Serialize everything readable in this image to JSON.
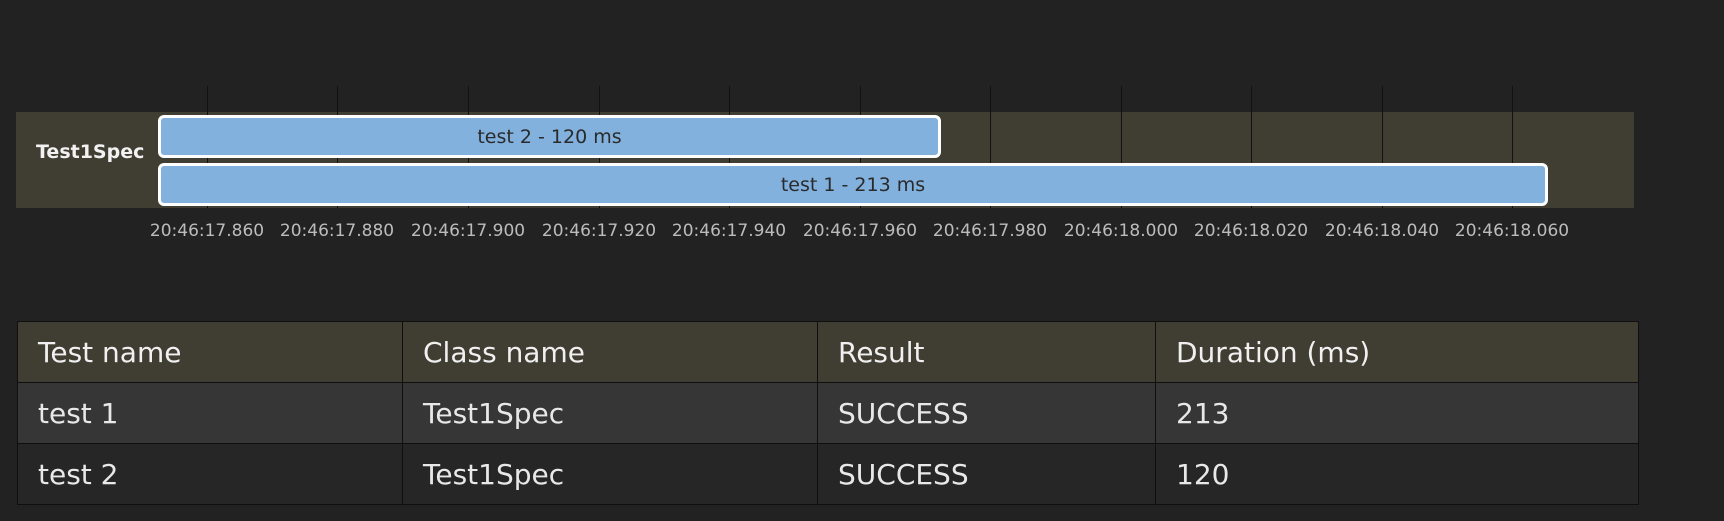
{
  "timeline": {
    "group": "Test1Spec",
    "range": {
      "start": 17.85,
      "end": 18.075
    },
    "ticks": [
      "20:46:17.860",
      "20:46:17.880",
      "20:46:17.900",
      "20:46:17.920",
      "20:46:17.940",
      "20:46:17.960",
      "20:46:17.980",
      "20:46:18.000",
      "20:46:18.020",
      "20:46:18.040",
      "20:46:18.060"
    ],
    "tick_values": [
      17.86,
      17.88,
      17.9,
      17.92,
      17.94,
      17.96,
      17.98,
      18.0,
      18.02,
      18.04,
      18.06
    ],
    "bars": [
      {
        "label": "test 2 - 120 ms",
        "start": 17.8525,
        "duration_ms": 120
      },
      {
        "label": "test 1 - 213 ms",
        "start": 17.8525,
        "duration_ms": 213
      }
    ],
    "bar_color": "#82b1de",
    "band_color": "#403e33"
  },
  "table": {
    "headers": [
      "Test name",
      "Class name",
      "Result",
      "Duration (ms)"
    ],
    "rows": [
      [
        "test 1",
        "Test1Spec",
        "SUCCESS",
        "213"
      ],
      [
        "test 2",
        "Test1Spec",
        "SUCCESS",
        "120"
      ]
    ]
  }
}
